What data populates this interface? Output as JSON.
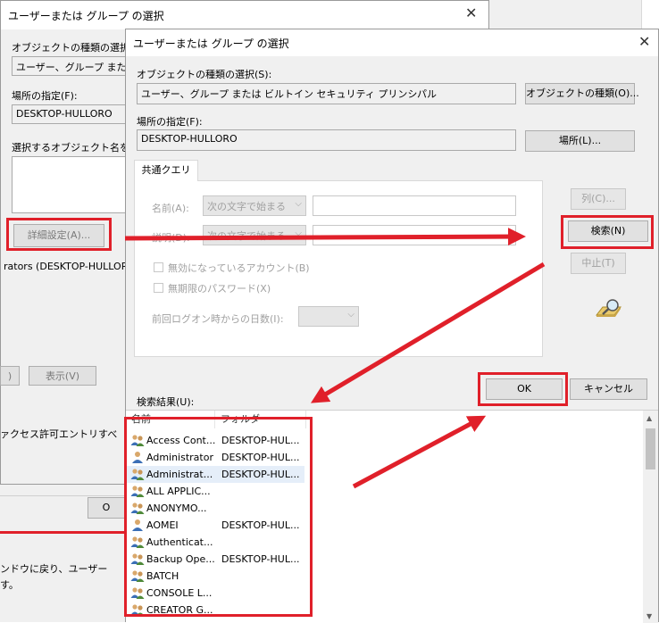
{
  "background_dialog": {
    "title": "ユーザーまたは グループ の選択",
    "object_type_label": "オブジェクトの種類の選択(S",
    "object_type_value": "ユーザー、グループ または ビ",
    "location_label": "場所の指定(F):",
    "location_value": "DESKTOP-HULLORO",
    "enter_names_label": "選択するオブジェクト名を入",
    "advanced_button": "詳細設定(A)...",
    "principal_text": "rators (DESKTOP-HULLOR...",
    "show_button": "表示(V)",
    "left_button_fragment": ")",
    "access_text": "ァクセス許可エントリすべ",
    "ok_fragment": "O",
    "instruction_line1": "ンドウに戻り、ユーザー",
    "instruction_line2": "す。"
  },
  "dialog": {
    "title": "ユーザーまたは グループ の選択",
    "object_type_label": "オブジェクトの種類の選択(S):",
    "object_type_value": "ユーザー、グループ または ビルトイン セキュリティ プリンシパル",
    "object_types_button": "オブジェクトの種類(O)...",
    "location_label": "場所の指定(F):",
    "location_value": "DESKTOP-HULLORO",
    "locations_button": "場所(L)...",
    "tab_label": "共通クエリ",
    "name_label": "名前(A):",
    "name_combo": "次の文字で始まる",
    "desc_label": "説明(D):",
    "desc_combo": "次の文字で始まる",
    "disabled_accounts": "無効になっているアカウント(B)",
    "non_expiring_password": "無期限のパスワード(X)",
    "days_since_logon": "前回ログオン時からの日数(I):",
    "columns_button": "列(C)...",
    "find_now_button": "検索(N)",
    "stop_button": "中止(T)",
    "results_label": "検索結果(U):",
    "ok_button": "OK",
    "cancel_button": "キャンセル",
    "results": {
      "columns": [
        "名前",
        "フォルダー"
      ],
      "rows": [
        {
          "name": "Access Cont...",
          "folder": "DESKTOP-HUL...",
          "icon": "group-icon"
        },
        {
          "name": "Administrator",
          "folder": "DESKTOP-HUL...",
          "icon": "user-icon"
        },
        {
          "name": "Administrat...",
          "folder": "DESKTOP-HUL...",
          "icon": "group-icon"
        },
        {
          "name": "ALL APPLIC...",
          "folder": "",
          "icon": "group-icon"
        },
        {
          "name": "ANONYMO...",
          "folder": "",
          "icon": "group-icon"
        },
        {
          "name": "AOMEI",
          "folder": "DESKTOP-HUL...",
          "icon": "user-icon"
        },
        {
          "name": "Authenticat...",
          "folder": "",
          "icon": "group-icon"
        },
        {
          "name": "Backup Ope...",
          "folder": "DESKTOP-HUL...",
          "icon": "group-icon"
        },
        {
          "name": "BATCH",
          "folder": "",
          "icon": "group-icon"
        },
        {
          "name": "CONSOLE L...",
          "folder": "",
          "icon": "group-icon"
        },
        {
          "name": "CREATOR G...",
          "folder": "",
          "icon": "group-icon"
        }
      ]
    }
  },
  "colors": {
    "annotation_red": "#e0202a",
    "dialog_bg": "#f0f0f0",
    "selected_row": "#e5eef9"
  }
}
